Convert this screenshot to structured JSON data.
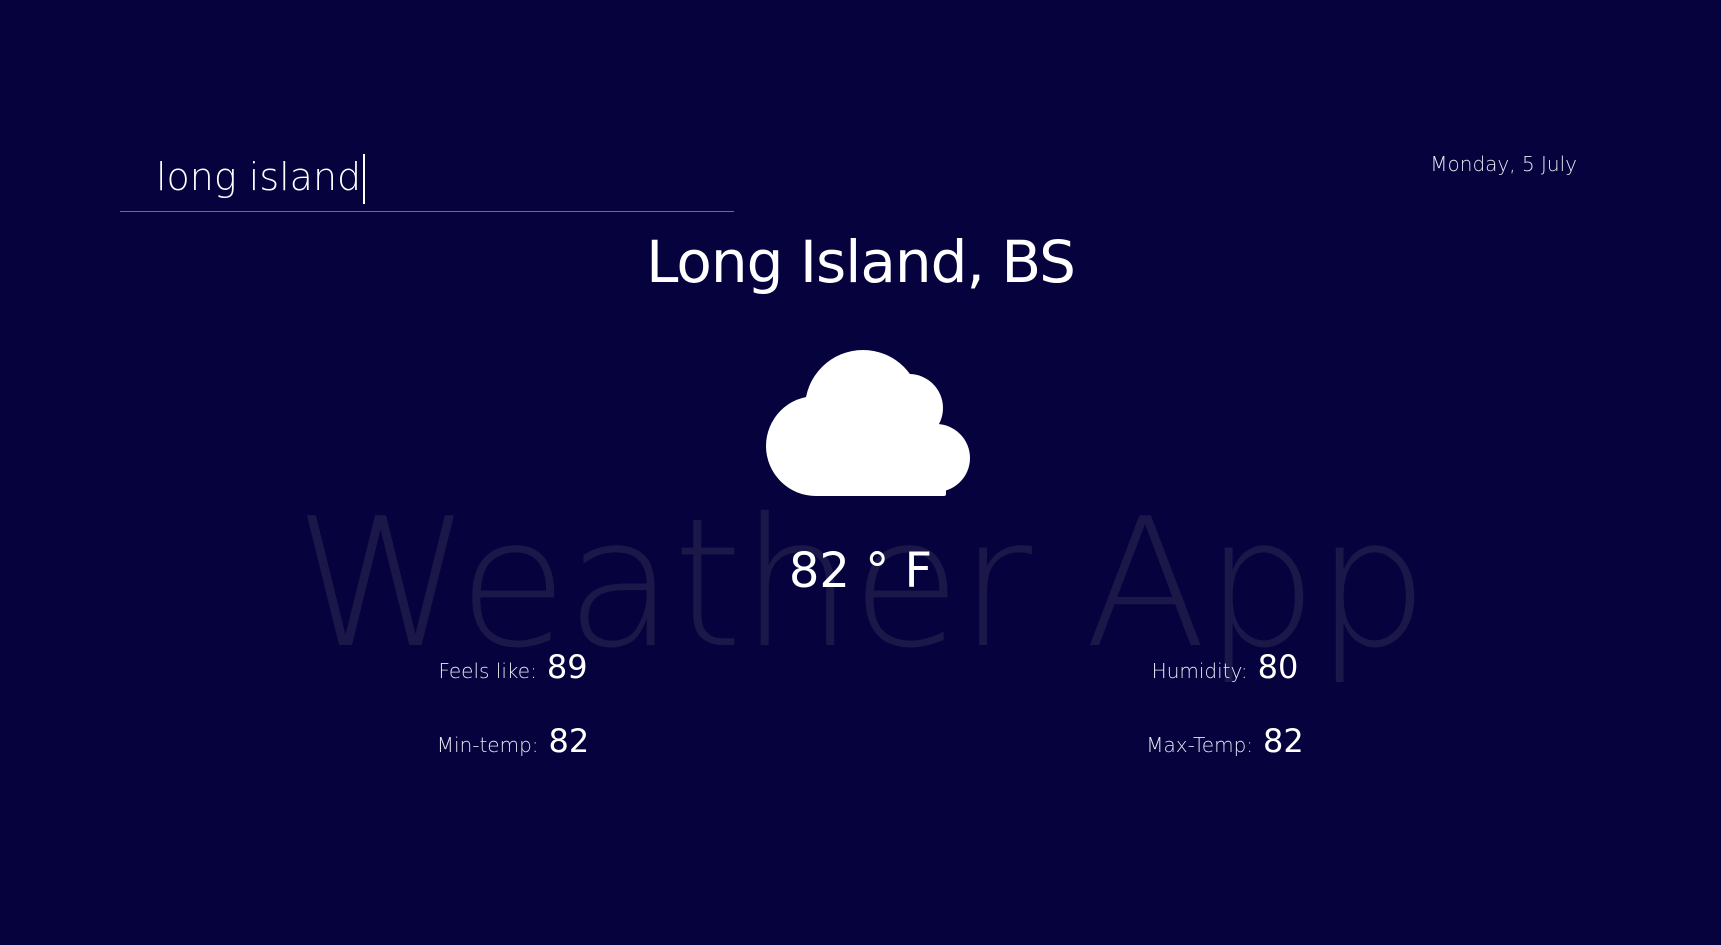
{
  "app": {
    "watermark": "Weather App"
  },
  "search": {
    "value": "long island",
    "placeholder": ""
  },
  "header": {
    "date": "Monday, 5 July"
  },
  "weather": {
    "location": "Long Island, BS",
    "icon": "cloud-icon",
    "temperature": "82 ° F"
  },
  "stats": {
    "feels_like": {
      "label": "Feels like:",
      "value": "89"
    },
    "humidity": {
      "label": "Humidity:",
      "value": "80"
    },
    "min_temp": {
      "label": "Min-temp:",
      "value": "82"
    },
    "max_temp": {
      "label": "Max-Temp:",
      "value": "82"
    }
  },
  "colors": {
    "background": "#06023d",
    "text": "#ffffff",
    "watermark": "#1b1849",
    "underline": "#6f6d8f"
  }
}
